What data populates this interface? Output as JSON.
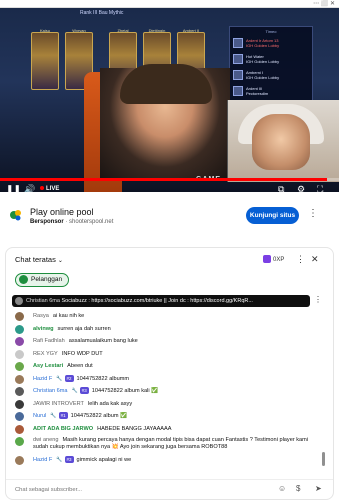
{
  "browser": {
    "extension_icons": "⋯  ⬜  ✕"
  },
  "video": {
    "game_header": "Rank III Bau Mythic",
    "heroes": [
      {
        "name": "Kaisu"
      },
      {
        "name": "Wyryan"
      },
      {
        "name": "Zhetal"
      },
      {
        "name": "Diettingin"
      },
      {
        "name": "Ambert II"
      }
    ],
    "side_panel": {
      "header": "Timeo",
      "rows": [
        {
          "title": "Ardent Ir Artom 13",
          "sub": "IGH Golden Lobby",
          "red": true
        },
        {
          "title": "Hot Water",
          "sub": "IGH Golden Lobby",
          "red": false
        },
        {
          "title": "Amberni I",
          "sub": "IGH Golden Lobby",
          "red": false
        },
        {
          "title": "Ardent III",
          "sub": "Pectoresdim",
          "red": false
        },
        {
          "title": "IGH Golden Lobby",
          "sub": "",
          "red": false
        }
      ]
    },
    "overlay_logo": "GAME",
    "live_label": "LIVE",
    "progress": 0.965,
    "controls": {
      "pause": "❚❚",
      "volume": "🔊",
      "subtitles": "⧉",
      "settings": "⚙",
      "miniplayer": "▭",
      "cast": "⎚",
      "fullscreen": "⛶"
    }
  },
  "ad": {
    "title": "Play online pool",
    "sponsor_label": "Bersponsor",
    "sponsor_domain": "· shooterspool.net",
    "cta": "Kunjungi situs",
    "more": "⋮"
  },
  "chat": {
    "title": "Chat teratas",
    "chevron": "⌄",
    "xp": "0XP",
    "more": "⋮",
    "close": "✕",
    "members_button": "Pelanggan",
    "pinned": {
      "name": "Christian 6ma",
      "text": "Sociabuzz : https://sociabuzz.com/btriuke || Join dc : https://discord.gg/KRqR..."
    },
    "messages": [
      {
        "name": "Rasya",
        "badge": "",
        "text": "ai kau nih ke",
        "avatar": "#8a6a4a",
        "style": "plain"
      },
      {
        "name": "alvinwg",
        "badge": "",
        "text": "surren aja dah surren",
        "avatar": "#2c9a8a",
        "style": "green"
      },
      {
        "name": "Rafi Fadhlah",
        "badge": "",
        "text": "assalamualaikum bang luke",
        "avatar": "#8a4aa8",
        "style": "plain"
      },
      {
        "name": "REX YGY",
        "badge": "",
        "text": "INFO WDP DUT",
        "avatar": "#c9c9c9",
        "style": "plain"
      },
      {
        "name": "Asy Lestari",
        "badge": "",
        "text": "Abeen dut",
        "avatar": "#6aa84a",
        "style": "green"
      },
      {
        "name": "Hazid F",
        "badge": "#2",
        "text": "1044752822 albumm",
        "avatar": "#9a7a5a",
        "style": "blue"
      },
      {
        "name": "Christian 6ma",
        "badge": "#3",
        "text": "1044752822 album kali ✅",
        "avatar": "#5a5a5a",
        "style": "blue"
      },
      {
        "name": "JAWIR INTROVERT",
        "badge": "",
        "text": "lelih ada kak asyy",
        "avatar": "#3a3a3a",
        "style": "plain"
      },
      {
        "name": "Nurul",
        "badge": "#1",
        "text": "1044752822 album ✅",
        "avatar": "#4a6a9a",
        "style": "blue"
      },
      {
        "name": "ADIT ADA BIG JARWO",
        "badge": "",
        "text": "HABEDE BANGG JAYAAAAA",
        "avatar": "#aa5a3a",
        "style": "green"
      },
      {
        "name": "dwi aneng",
        "badge": "",
        "text": "Masih kurang percaya hanya dengan modal tipis bisa dapat cuan Fantastis ? Testimoni player kami sudah cukup membuktikan nya 💥 Ayo join sekarang juga bersama ROBOT88",
        "avatar": "#5aa84a",
        "style": "tall"
      },
      {
        "name": "Hazid F",
        "badge": "#3",
        "text": "gimmick apalagi ni we",
        "avatar": "#9a7a5a",
        "style": "blue"
      }
    ],
    "input_placeholder": "Chat sebagai subscriber...",
    "emoji_icon": "☺",
    "money_icon": "$",
    "send_icon": "➤"
  }
}
